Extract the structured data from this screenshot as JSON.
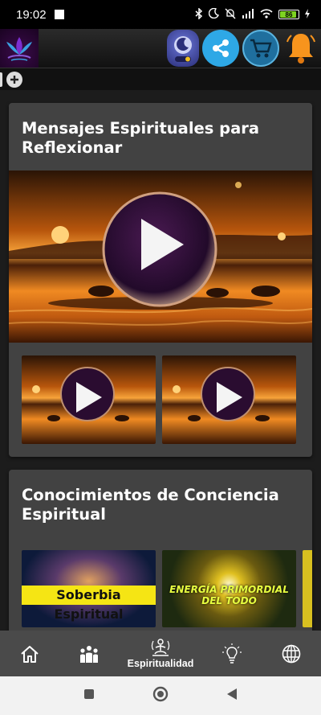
{
  "status_bar": {
    "time": "19:02",
    "battery": "86"
  },
  "header": {
    "logo": "lotus-logo",
    "icons": [
      "moon-toggle-icon",
      "share-icon",
      "cart-icon",
      "bell-icon"
    ]
  },
  "section1": {
    "title": "Mensajes Espirituales para Reflexionar"
  },
  "section2": {
    "title": "Conocimientos de Conciencia Espiritual",
    "thumbs": [
      {
        "label": "Soberbia Espiritual"
      },
      {
        "label": "ENERGÍA PRIMORDIAL DEL TODO"
      }
    ]
  },
  "bottom_nav": {
    "items": [
      {
        "icon": "home-icon",
        "label": ""
      },
      {
        "icon": "community-icon",
        "label": ""
      },
      {
        "icon": "spirituality-icon",
        "label": "Espiritualidad"
      },
      {
        "icon": "lightbulb-icon",
        "label": ""
      },
      {
        "icon": "globe-icon",
        "label": ""
      }
    ]
  },
  "colors": {
    "background": "#1c1c1c",
    "card": "#424242",
    "nav": "#4a4a4a",
    "share": "#2ea8e6",
    "banner": "#f5e514"
  }
}
